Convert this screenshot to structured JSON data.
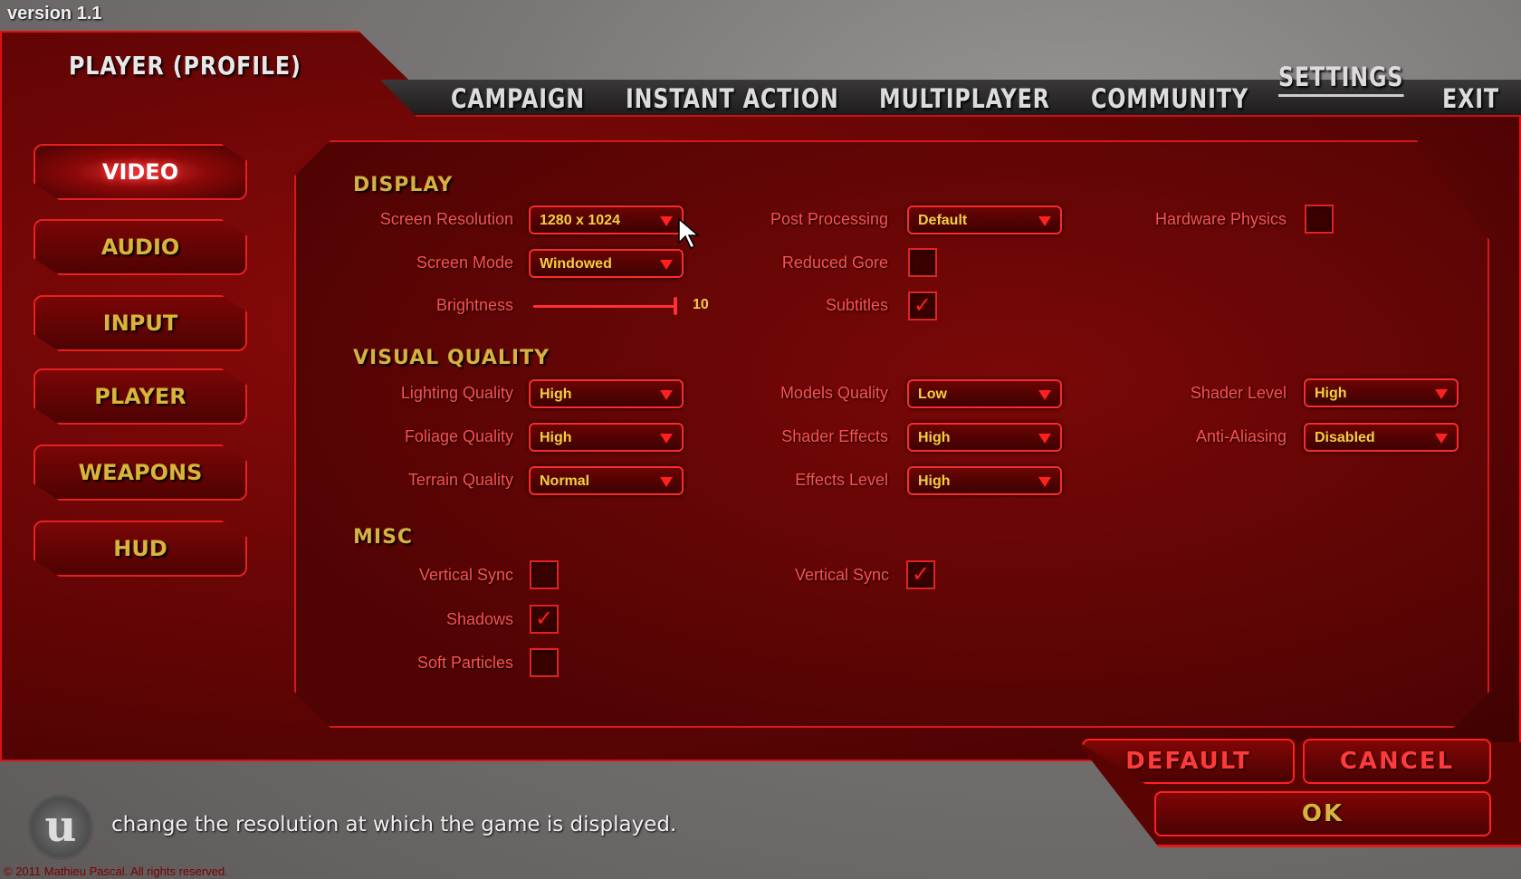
{
  "version": "version 1.1",
  "profile_title": "PLAYER (PROFILE)",
  "nav": [
    {
      "label": "CAMPAIGN"
    },
    {
      "label": "INSTANT ACTION"
    },
    {
      "label": "MULTIPLAYER"
    },
    {
      "label": "COMMUNITY"
    },
    {
      "label": "SETTINGS",
      "active": true
    },
    {
      "label": "EXIT"
    }
  ],
  "sidebar": [
    {
      "label": "VIDEO",
      "active": true
    },
    {
      "label": "AUDIO"
    },
    {
      "label": "INPUT"
    },
    {
      "label": "PLAYER"
    },
    {
      "label": "WEAPONS"
    },
    {
      "label": "HUD"
    }
  ],
  "display": {
    "title": "DISPLAY",
    "screen_resolution": {
      "label": "Screen Resolution",
      "value": "1280 x 1024"
    },
    "screen_mode": {
      "label": "Screen Mode",
      "value": "Windowed"
    },
    "brightness": {
      "label": "Brightness",
      "value": "10"
    },
    "post_processing": {
      "label": "Post Processing",
      "value": "Default"
    },
    "reduced_gore": {
      "label": "Reduced Gore",
      "checked": false
    },
    "subtitles": {
      "label": "Subtitles",
      "checked": true
    },
    "hardware_physics": {
      "label": "Hardware Physics",
      "checked": false
    }
  },
  "visual": {
    "title": "VISUAL QUALITY",
    "lighting": {
      "label": "Lighting Quality",
      "value": "High"
    },
    "foliage": {
      "label": "Foliage Quality",
      "value": "High"
    },
    "terrain": {
      "label": "Terrain Quality",
      "value": "Normal"
    },
    "models": {
      "label": "Models Quality",
      "value": "Low"
    },
    "shader_effects": {
      "label": "Shader Effects",
      "value": "High"
    },
    "effects_level": {
      "label": "Effects Level",
      "value": "High"
    },
    "shader_level": {
      "label": "Shader Level",
      "value": "High"
    },
    "anti_aliasing": {
      "label": "Anti-Aliasing",
      "value": "Disabled"
    }
  },
  "misc": {
    "title": "MISC",
    "vsync1": {
      "label": "Vertical Sync",
      "checked": false
    },
    "shadows": {
      "label": "Shadows",
      "checked": true
    },
    "soft_particles": {
      "label": "Soft Particles",
      "checked": false
    },
    "vsync2": {
      "label": "Vertical Sync",
      "checked": true
    }
  },
  "buttons": {
    "default": "DEFAULT",
    "cancel": "CANCEL",
    "ok": "OK"
  },
  "hint": "change the resolution at which the game is displayed.",
  "logo_letter": "u",
  "copyright": "© 2011 Mathieu Pascal. All rights reserved.",
  "colors": {
    "accent": "#e01818",
    "label": "#ff5050",
    "value": "#f0d040",
    "heading": "#d6b040"
  },
  "check_glyph": "✓"
}
